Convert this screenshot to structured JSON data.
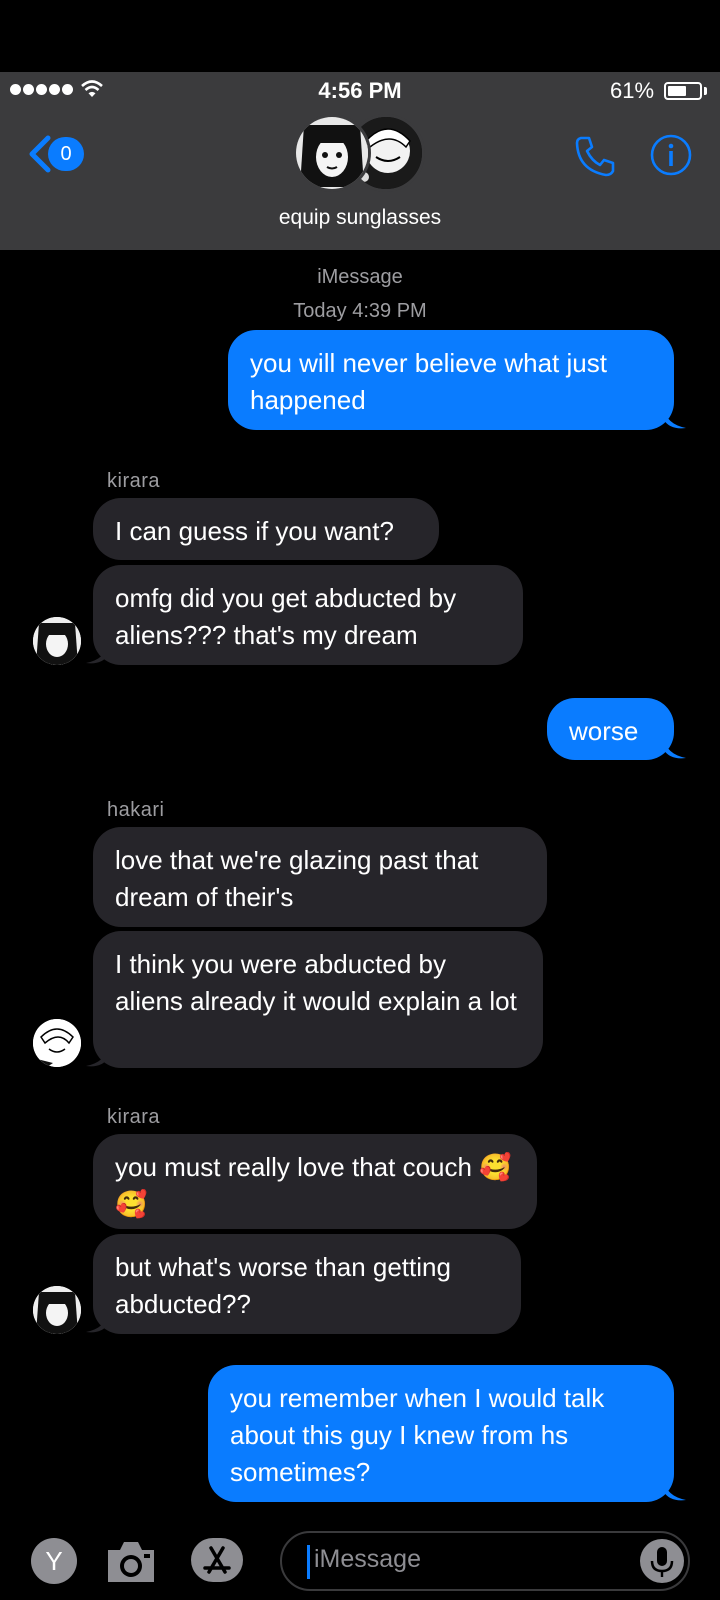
{
  "status_bar": {
    "time": "4:56 PM",
    "battery_percent": "61%",
    "battery_level": 0.61
  },
  "nav": {
    "back_badge": "0",
    "group_name": "equip sunglasses"
  },
  "thread": {
    "service_label": "iMessage",
    "timestamp": "Today 4:39 PM",
    "messages": [
      {
        "direction": "outgoing",
        "text": "you will never believe what just happened"
      },
      {
        "direction": "incoming",
        "sender": "kirara",
        "text": "I can guess if you want?"
      },
      {
        "direction": "incoming",
        "sender": "kirara",
        "text": "omfg did you get abducted by aliens??? that's my dream"
      },
      {
        "direction": "outgoing",
        "text": "worse"
      },
      {
        "direction": "incoming",
        "sender": "hakari",
        "text": "love that we're glazing past that dream of their's"
      },
      {
        "direction": "incoming",
        "sender": "hakari",
        "text": "I think you were abducted by aliens already it would explain a lot"
      },
      {
        "direction": "incoming",
        "sender": "kirara",
        "text": "you must really love that couch 🥰🥰"
      },
      {
        "direction": "incoming",
        "sender": "kirara",
        "text": "but what's worse than getting abducted??"
      },
      {
        "direction": "outgoing",
        "text": "you remember when I would talk about this guy I knew from hs sometimes?"
      }
    ]
  },
  "input_bar": {
    "y_button": "Y",
    "placeholder": "iMessage"
  },
  "colors": {
    "accent": "#0a7cff",
    "incoming_bubble": "#26252a",
    "header": "#3b3b3d"
  }
}
